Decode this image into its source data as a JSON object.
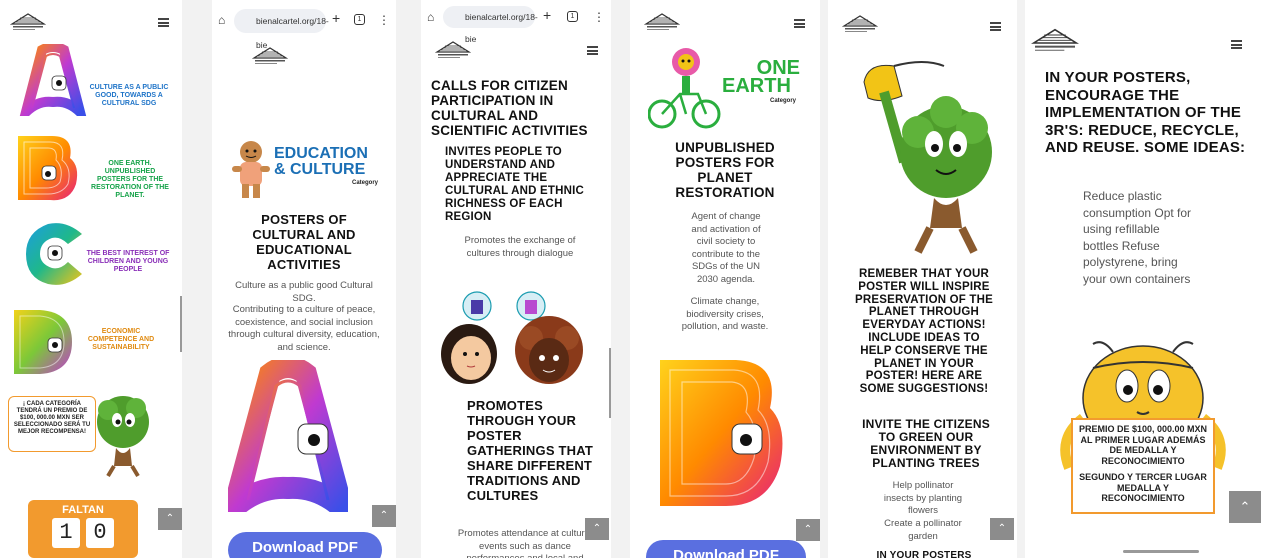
{
  "panel1": {
    "categories": [
      {
        "letter": "A",
        "label": "CULTURE AS A PUBLIC GOOD, TOWARDS A CULTURAL SDG",
        "color": "#1f74c8"
      },
      {
        "letter": "B",
        "label": "ONE EARTH. UNPUBLISHED POSTERS FOR THE RESTORATION OF THE PLANET.",
        "color": "#17a34a"
      },
      {
        "letter": "C",
        "label": "THE BEST INTEREST OF CHILDREN AND YOUNG PEOPLE",
        "color": "#8a2fb8"
      },
      {
        "letter": "D",
        "label": "ECONOMIC COMPETENCE AND SUSTAINABILITY",
        "color": "#e08a10"
      }
    ],
    "prize_banner": "¡ CADA CATEGORÍA TENDRÁ UN PREMIO DE $100, 000.00 MXN SER SELECCIONADO SERÁ TU MEJOR RECOMPENSA!",
    "countdown_label": "FALTAN",
    "countdown_digits": [
      "1",
      "0"
    ]
  },
  "panel2": {
    "url": "bienalcartel.org/18-bie",
    "category_title_1": "EDUCATION",
    "category_title_2": "& CULTURE",
    "category_sub": "Category",
    "heading": "POSTERS OF CULTURAL AND EDUCATIONAL ACTIVITIES",
    "para1": "Culture as a public good Cultural SDG.",
    "para2": "Contributing to a culture of peace, coexistence, and social inclusion through cultural diversity, education, and science.",
    "pdf_label": "Download PDF"
  },
  "panel3": {
    "url": "bienalcartel.org/18-bie",
    "heading1": "CALLS FOR CITIZEN PARTICIPATION IN CULTURAL AND SCIENTIFIC ACTIVITIES",
    "heading2": "INVITES PEOPLE TO UNDERSTAND AND APPRECIATE THE CULTURAL AND ETHNIC RICHNESS OF EACH REGION",
    "para1": "Promotes the exchange of cultures through dialogue",
    "heading3": "PROMOTES THROUGH YOUR POSTER GATHERINGS THAT SHARE DIFFERENT TRADITIONS AND CULTURES",
    "para2": "Promotes attendance at cultural events such as dance performances and local and"
  },
  "panel4": {
    "category_title_1": "ONE",
    "category_title_2": "EARTH",
    "category_sub": "Category",
    "heading": "UNPUBLISHED POSTERS FOR PLANET RESTORATION",
    "para1": "Agent of change and activation of civil society to contribute to the SDGs of the UN 2030 agenda.",
    "para2": "Climate change, biodiversity crises, pollution, and waste.",
    "pdf_label": "Download PDF"
  },
  "panel5": {
    "heading1": "REMEBER THAT YOUR POSTER WILL INSPIRE PRESERVATION OF THE PLANET THROUGH EVERYDAY ACTIONS! INCLUDE IDEAS TO HELP CONSERVE THE PLANET IN YOUR POSTER! HERE ARE SOME SUGGESTIONS!",
    "heading2": "INVITE THE CITIZENS TO GREEN OUR ENVIRONMENT BY PLANTING TREES",
    "para1": "Help pollinator insects by planting flowers",
    "para2": "Create a pollinator garden",
    "heading3": "IN YOUR POSTERS"
  },
  "panel6": {
    "heading": "IN YOUR POSTERS, ENCOURAGE THE IMPLEMENTATION OF THE 3R'S: REDUCE, RECYCLE, AND REUSE. SOME IDEAS:",
    "ideas": "Reduce plastic consumption Opt for using refillable bottles Refuse polystyrene, bring your own containers",
    "prize_line1": "PREMIO DE $100, 000.00 MXN AL PRIMER LUGAR ADEMÁS DE MEDALLA Y RECONOCIMIENTO",
    "prize_line2": "SEGUNDO Y TERCER LUGAR MEDALLA Y RECONOCIMIENTO"
  },
  "colors": {
    "pdf_button": "#5a6fe0",
    "orange": "#f29a2e",
    "tree_green": "#4f9d2c",
    "education_blue": "#1b6fb5",
    "one_earth_green": "#2aae3e"
  }
}
